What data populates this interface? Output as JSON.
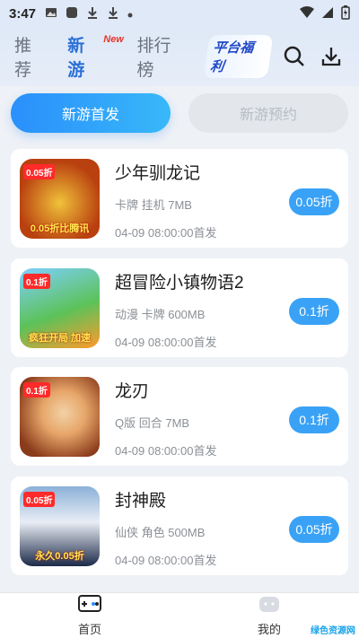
{
  "status": {
    "time": "3:47"
  },
  "header": {
    "tabs": [
      {
        "label": "推荐"
      },
      {
        "label": "新游",
        "badge": "New"
      },
      {
        "label": "排行榜"
      }
    ],
    "welfare_label": "平台福利"
  },
  "segment": {
    "first": "新游首发",
    "second": "新游预约"
  },
  "games": [
    {
      "name": "少年驯龙记",
      "meta": "卡牌 挂机 7MB",
      "date": "04-09 08:00:00首发",
      "discount": "0.05折",
      "tag": "0.05折",
      "thumb_text": "0.05折比腾讯",
      "colors": [
        "#b9400f",
        "#f0c23a"
      ]
    },
    {
      "name": "超冒险小镇物语2",
      "meta": "动漫 卡牌 600MB",
      "date": "04-09 08:00:00首发",
      "discount": "0.1折",
      "tag": "0.1折",
      "thumb_text": "疯狂开局 加速",
      "colors": [
        "#5cc25a",
        "#ff9a2a"
      ]
    },
    {
      "name": "龙刃",
      "meta": "Q版 回合 7MB",
      "date": "04-09 08:00:00首发",
      "discount": "0.1折",
      "tag": "0.1折",
      "thumb_text": "",
      "colors": [
        "#8a3b1a",
        "#e7a66a"
      ]
    },
    {
      "name": "封神殿",
      "meta": "仙侠 角色 500MB",
      "date": "04-09 08:00:00首发",
      "discount": "0.05折",
      "tag": "0.05折",
      "thumb_text": "永久0.05折",
      "colors": [
        "#1c2a48",
        "#8cb0d8"
      ]
    }
  ],
  "bottomnav": {
    "home": "首页",
    "mine": "我的"
  },
  "watermark": "绿色资源网"
}
